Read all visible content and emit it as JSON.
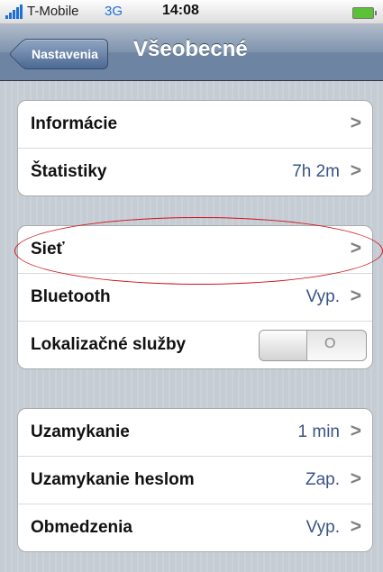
{
  "status_bar": {
    "carrier": "T-Mobile",
    "network": "3G",
    "time": "14:08",
    "signal_color": "#1f6fd6",
    "battery_color": "#5bc236"
  },
  "nav": {
    "back_label": "Nastavenia",
    "title": "Všeobecné"
  },
  "groups": [
    {
      "rows": [
        {
          "label": "Informácie",
          "value": ""
        },
        {
          "label": "Štatistiky",
          "value": "7h 2m"
        }
      ]
    },
    {
      "rows": [
        {
          "label": "Sieť",
          "value": ""
        },
        {
          "label": "Bluetooth",
          "value": "Vyp."
        },
        {
          "label": "Lokalizačné služby",
          "toggle": "O"
        }
      ]
    },
    {
      "rows": [
        {
          "label": "Uzamykanie",
          "value": "1 min"
        },
        {
          "label": "Uzamykanie heslom",
          "value": "Zap."
        },
        {
          "label": "Obmedzenia",
          "value": "Vyp."
        }
      ]
    }
  ],
  "chevron_glyph": ">",
  "highlight_color": "#d2121a",
  "value_color": "#385487"
}
